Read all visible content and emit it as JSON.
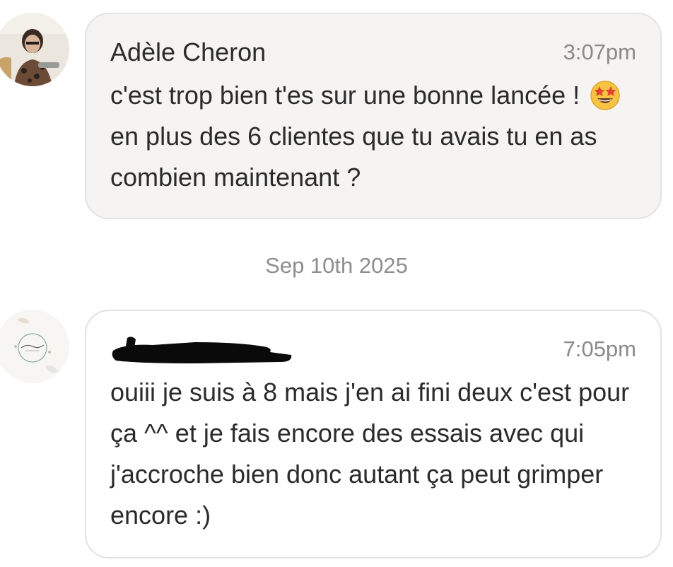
{
  "messages": [
    {
      "sender": "Adèle Cheron",
      "time": "3:07pm",
      "text_before_emoji": "c'est trop bien t'es sur une bonne lancée ! ",
      "emoji": "star-struck-emoji",
      "text_after_emoji": "en plus des 6 clientes que tu avais tu en as combien maintenant ?"
    },
    {
      "sender_redacted": true,
      "time": "7:05pm",
      "text": "ouiii je suis à 8 mais j'en ai fini deux c'est pour ça ^^ et je fais encore des essais avec qui j'accroche bien donc autant ça peut grimper encore :)"
    }
  ],
  "date_separator": "Sep 10th 2025",
  "colors": {
    "bubble_received": "#f5f4f3",
    "bubble_sent": "#ffffff",
    "bubble_border": "#e2e2e2",
    "timestamp": "#8a8a8a",
    "separator_text": "#8d8d8d"
  }
}
